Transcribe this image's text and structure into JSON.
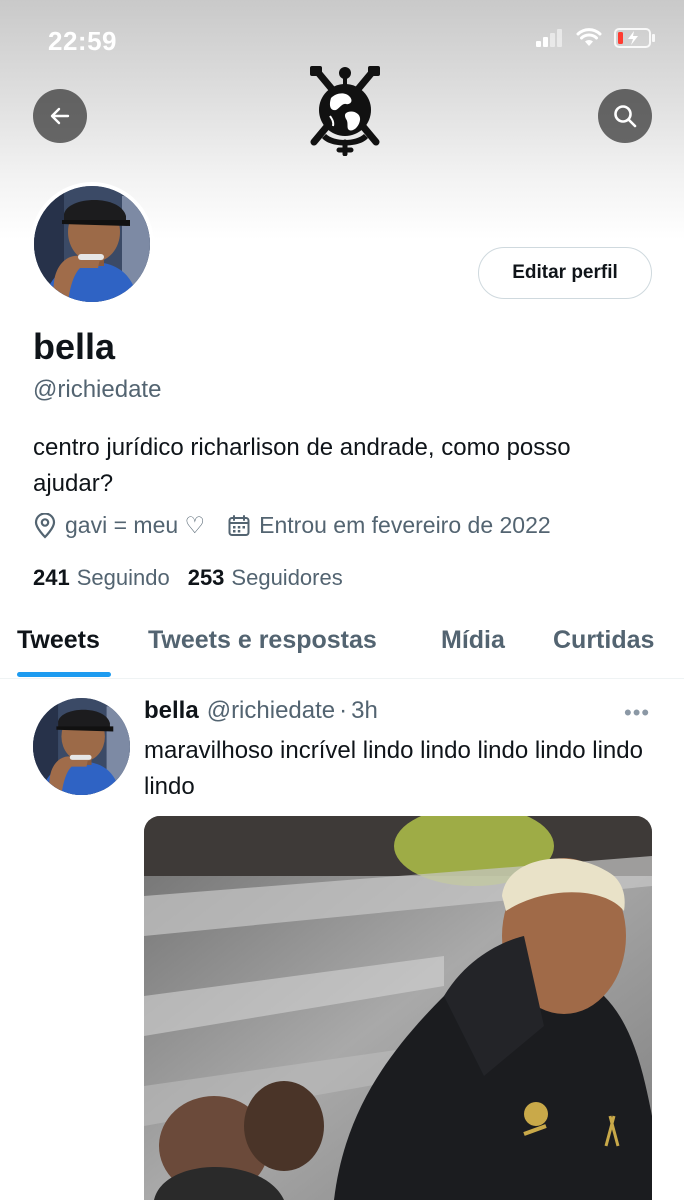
{
  "status_bar": {
    "time": "22:59"
  },
  "profile": {
    "display_name": "bella",
    "handle": "@richiedate",
    "bio": "centro jurídico richarlison de andrade, como posso ajudar?",
    "location": "gavi = meu ♡",
    "joined": "Entrou em fevereiro de 2022",
    "following_count": "241",
    "following_label": "Seguindo",
    "followers_count": "253",
    "followers_label": "Seguidores",
    "edit_button_label": "Editar perfil"
  },
  "tabs": [
    {
      "label": "Tweets",
      "active": true
    },
    {
      "label": "Tweets e respostas",
      "active": false
    },
    {
      "label": "Mídia",
      "active": false
    },
    {
      "label": "Curtidas",
      "active": false
    }
  ],
  "tweet": {
    "name": "bella",
    "handle": "@richiedate",
    "separator": "·",
    "time": "3h",
    "text": "maravilhoso incrível lindo lindo lindo lindo lindo lindo",
    "more_label": "•••"
  },
  "icons": {
    "back": "arrow-left-icon",
    "search": "search-icon",
    "location": "location-pin-icon",
    "calendar": "calendar-icon",
    "logo": "club-crest-logo"
  },
  "colors": {
    "accent": "#1d9bf0",
    "secondary_text": "#536471",
    "primary_text": "#0f1419",
    "battery_low": "#ff3b30"
  }
}
